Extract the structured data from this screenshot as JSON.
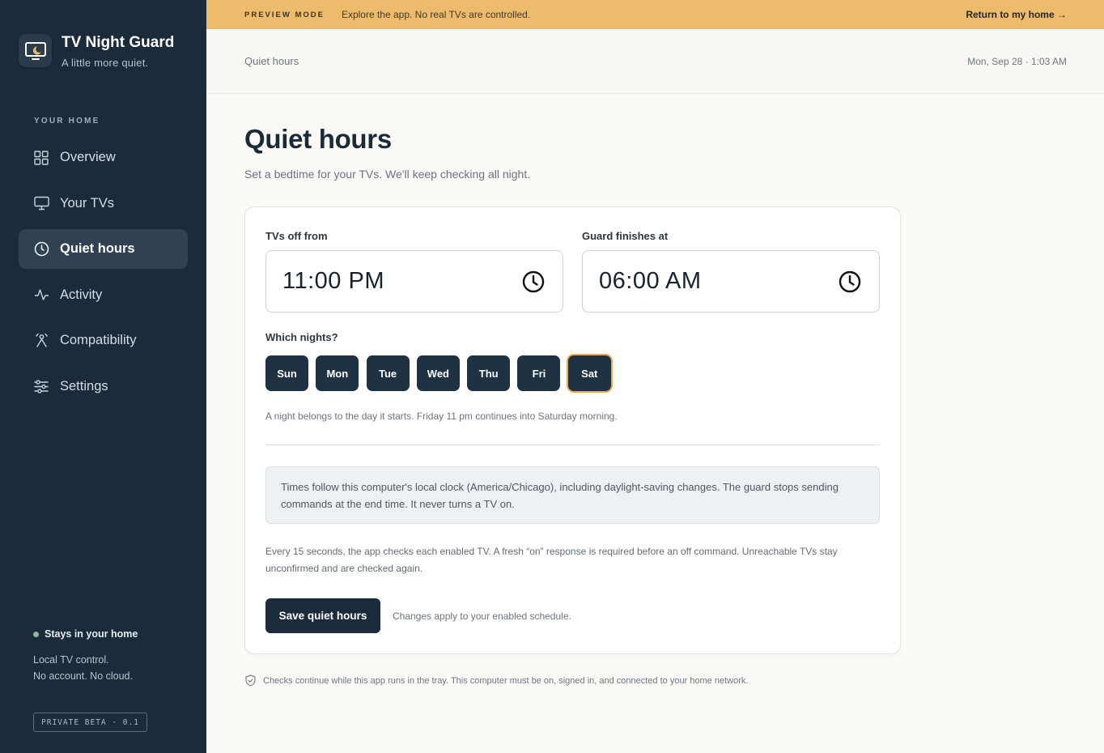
{
  "app": {
    "title": "TV Night Guard",
    "tagline": "A little more quiet.",
    "logo_icon": "tv-moon-icon"
  },
  "sidebar": {
    "section_label": "YOUR HOME",
    "items": [
      {
        "label": "Overview",
        "icon": "grid-icon",
        "active": false
      },
      {
        "label": "Your TVs",
        "icon": "monitor-icon",
        "active": false
      },
      {
        "label": "Quiet hours",
        "icon": "clock-icon",
        "active": true
      },
      {
        "label": "Activity",
        "icon": "activity-icon",
        "active": false
      },
      {
        "label": "Compatibility",
        "icon": "compatibility-icon",
        "active": false
      },
      {
        "label": "Settings",
        "icon": "sliders-icon",
        "active": false
      }
    ],
    "status_title": "Stays in your home",
    "status_line1": "Local TV control.",
    "status_line2": "No account. No cloud.",
    "badge": "PRIVATE BETA · 0.1"
  },
  "banner": {
    "tag": "PREVIEW MODE",
    "message": "Explore the app. No real TVs are controlled.",
    "link": "Return to my home →",
    "color": "#ecbb6c"
  },
  "topbar": {
    "breadcrumb": "Quiet hours",
    "datetime": "Mon, Sep 28 · 1:03 AM"
  },
  "page": {
    "title": "Quiet hours",
    "subtitle": "Set a bedtime for your TVs. We'll keep checking all night."
  },
  "form": {
    "start_label": "TVs off from",
    "start_value": "11:00 PM",
    "end_label": "Guard finishes at",
    "end_value": "06:00 AM",
    "nights_label": "Which nights?",
    "days": [
      {
        "label": "Sun",
        "selected": true
      },
      {
        "label": "Mon",
        "selected": true
      },
      {
        "label": "Tue",
        "selected": true
      },
      {
        "label": "Wed",
        "selected": true
      },
      {
        "label": "Thu",
        "selected": true
      },
      {
        "label": "Fri",
        "selected": true
      },
      {
        "label": "Sat",
        "selected": true,
        "focused": true
      }
    ],
    "night_note": "A night belongs to the day it starts. Friday 11 pm continues into Saturday morning.",
    "info": "Times follow this computer's local clock (America/Chicago), including daylight-saving changes. The guard stops sending commands at the end time. It never turns a TV on.",
    "check_note": "Every 15 seconds, the app checks each enabled TV. A fresh “on” response is required before an off command. Unreachable TVs stay unconfirmed and are checked again.",
    "save_label": "Save quiet hours",
    "save_hint": "Changes apply to your enabled schedule."
  },
  "footer_note": "Checks continue while this app runs in the tray. This computer must be on, signed in, and connected to your home network.",
  "colors": {
    "sidebar_bg": "#1b2b3c",
    "accent": "#ecbb6c",
    "primary_button": "#1b2b3c",
    "day_chip": "#1f3244",
    "focus_ring": "#e8ac4c"
  }
}
